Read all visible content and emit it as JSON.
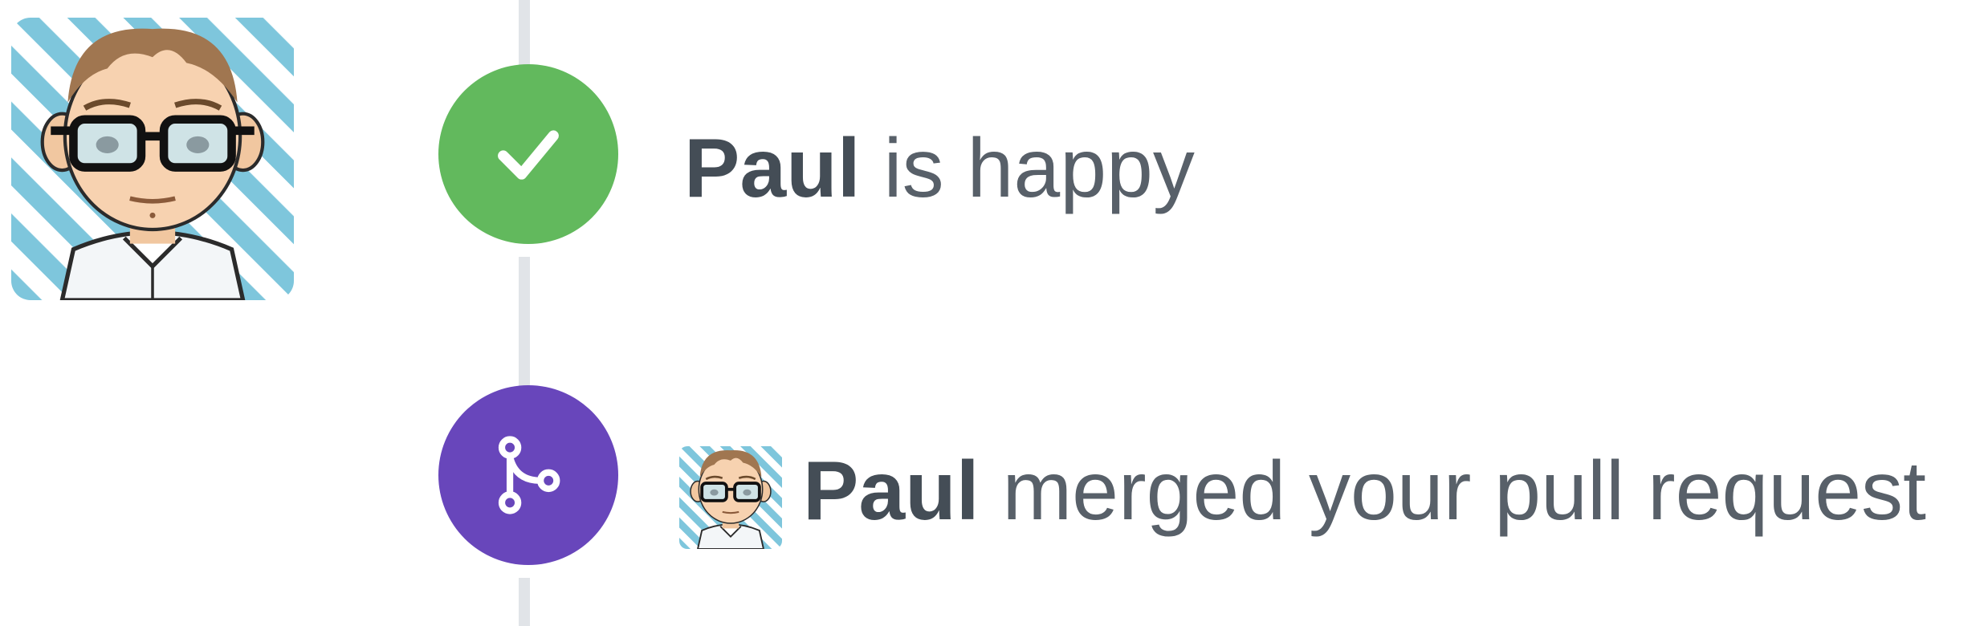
{
  "colors": {
    "timeline": "#e1e4e8",
    "success_badge": "#62b95d",
    "merged_badge": "#6846bb",
    "text_muted": "#586069",
    "text_actor": "#444d56"
  },
  "author_avatar": {
    "icon": "user-avatar"
  },
  "events": [
    {
      "icon": "check-icon",
      "actor": "Paul",
      "action": " is happy"
    },
    {
      "icon": "git-merge-icon",
      "actor": "Paul",
      "action": " merged your pull request"
    }
  ]
}
